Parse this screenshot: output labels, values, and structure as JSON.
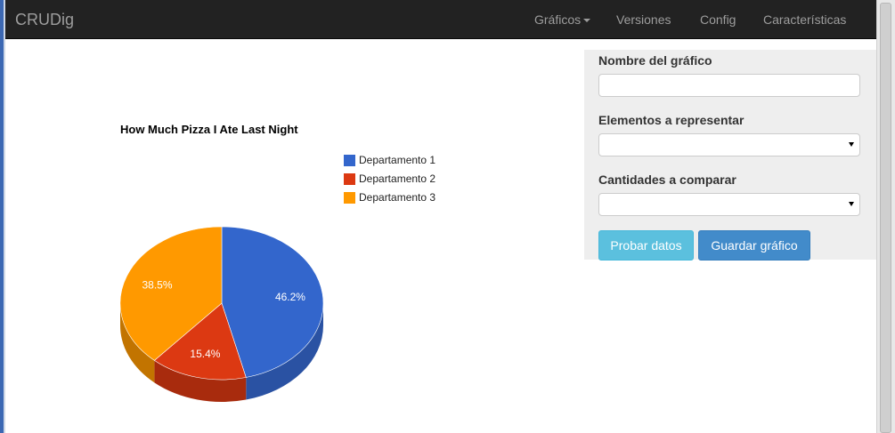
{
  "app": {
    "brand": "CRUDig"
  },
  "nav": {
    "graficos": "Gráficos",
    "versiones": "Versiones",
    "config": "Config",
    "caracteristicas": "Características"
  },
  "form": {
    "name_label": "Nombre del gráfico",
    "name_value": "",
    "elements_label": "Elementos a representar",
    "elements_value": "",
    "quantities_label": "Cantidades a comparar",
    "quantities_value": "",
    "test_button": "Probar datos",
    "save_button": "Guardar gráfico"
  },
  "colors": {
    "series1": "#3366cc",
    "series2": "#dc3912",
    "series3": "#ff9900",
    "series1_dark": "#2a52a3",
    "series2_dark": "#a82b0d",
    "series3_dark": "#c27400"
  },
  "chart_data": {
    "type": "pie",
    "title": "How Much Pizza I Ate Last Night",
    "categories": [
      "Departamento 1",
      "Departamento 2",
      "Departamento 3"
    ],
    "values": [
      46.2,
      15.4,
      38.5
    ],
    "labels": [
      "46.2%",
      "15.4%",
      "38.5%"
    ],
    "legend_position": "top-right",
    "style": "3d"
  }
}
